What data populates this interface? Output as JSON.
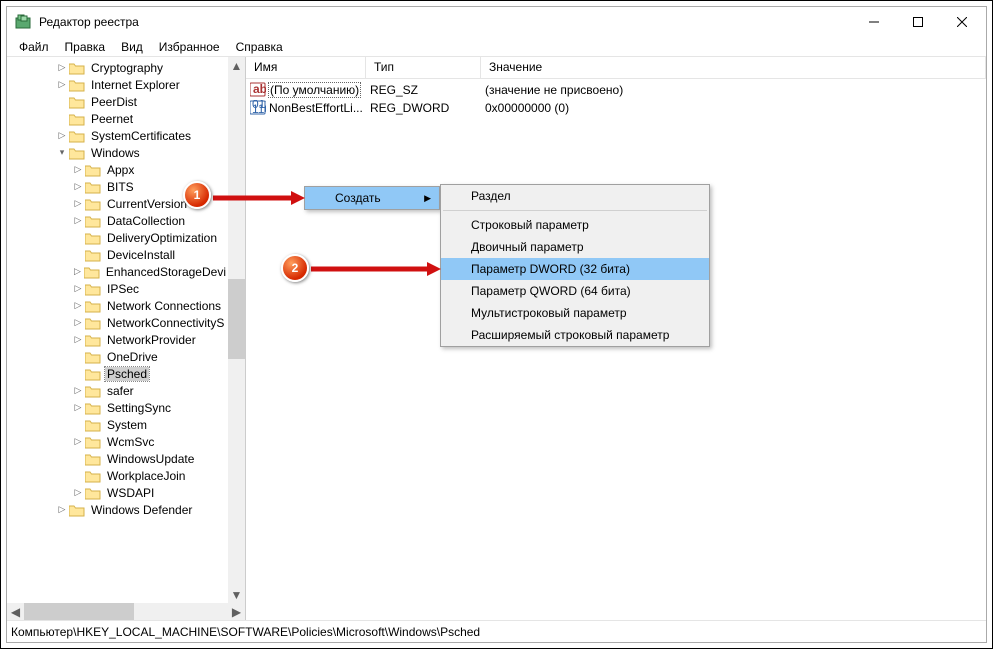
{
  "window": {
    "title": "Редактор реестра"
  },
  "menu": {
    "file": "Файл",
    "edit": "Правка",
    "view": "Вид",
    "favorites": "Избранное",
    "help": "Справка"
  },
  "tree": {
    "items": [
      {
        "indent": 3,
        "twisty": ">",
        "label": "Cryptography"
      },
      {
        "indent": 3,
        "twisty": ">",
        "label": "Internet Explorer"
      },
      {
        "indent": 3,
        "twisty": "",
        "label": "PeerDist"
      },
      {
        "indent": 3,
        "twisty": "",
        "label": "Peernet"
      },
      {
        "indent": 3,
        "twisty": ">",
        "label": "SystemCertificates"
      },
      {
        "indent": 3,
        "twisty": "v",
        "label": "Windows"
      },
      {
        "indent": 4,
        "twisty": ">",
        "label": "Appx"
      },
      {
        "indent": 4,
        "twisty": ">",
        "label": "BITS"
      },
      {
        "indent": 4,
        "twisty": ">",
        "label": "CurrentVersion"
      },
      {
        "indent": 4,
        "twisty": ">",
        "label": "DataCollection"
      },
      {
        "indent": 4,
        "twisty": "",
        "label": "DeliveryOptimization"
      },
      {
        "indent": 4,
        "twisty": "",
        "label": "DeviceInstall"
      },
      {
        "indent": 4,
        "twisty": ">",
        "label": "EnhancedStorageDevi"
      },
      {
        "indent": 4,
        "twisty": ">",
        "label": "IPSec"
      },
      {
        "indent": 4,
        "twisty": ">",
        "label": "Network Connections"
      },
      {
        "indent": 4,
        "twisty": ">",
        "label": "NetworkConnectivityS"
      },
      {
        "indent": 4,
        "twisty": ">",
        "label": "NetworkProvider"
      },
      {
        "indent": 4,
        "twisty": "",
        "label": "OneDrive"
      },
      {
        "indent": 4,
        "twisty": "",
        "label": "Psched",
        "selected": true
      },
      {
        "indent": 4,
        "twisty": ">",
        "label": "safer"
      },
      {
        "indent": 4,
        "twisty": ">",
        "label": "SettingSync"
      },
      {
        "indent": 4,
        "twisty": "",
        "label": "System"
      },
      {
        "indent": 4,
        "twisty": ">",
        "label": "WcmSvc"
      },
      {
        "indent": 4,
        "twisty": "",
        "label": "WindowsUpdate"
      },
      {
        "indent": 4,
        "twisty": "",
        "label": "WorkplaceJoin"
      },
      {
        "indent": 4,
        "twisty": ">",
        "label": "WSDAPI"
      },
      {
        "indent": 3,
        "twisty": ">",
        "label": "Windows Defender"
      }
    ]
  },
  "list": {
    "columns": {
      "name": "Имя",
      "type": "Тип",
      "value": "Значение"
    },
    "rows": [
      {
        "icon": "str",
        "name": "(По умолчанию)",
        "type": "REG_SZ",
        "value": "(значение не присвоено)",
        "focused": true
      },
      {
        "icon": "bin",
        "name": "NonBestEffortLi...",
        "type": "REG_DWORD",
        "value": "0x00000000 (0)"
      }
    ]
  },
  "context_menu": {
    "create": "Создать",
    "sub": {
      "key": "Раздел",
      "string": "Строковый параметр",
      "binary": "Двоичный параметр",
      "dword": "Параметр DWORD (32 бита)",
      "qword": "Параметр QWORD (64 бита)",
      "multi": "Мультистроковый параметр",
      "expand": "Расширяемый строковый параметр"
    }
  },
  "status": {
    "path": "Компьютер\\HKEY_LOCAL_MACHINE\\SOFTWARE\\Policies\\Microsoft\\Windows\\Psched"
  },
  "annotations": {
    "one": "1",
    "two": "2"
  }
}
